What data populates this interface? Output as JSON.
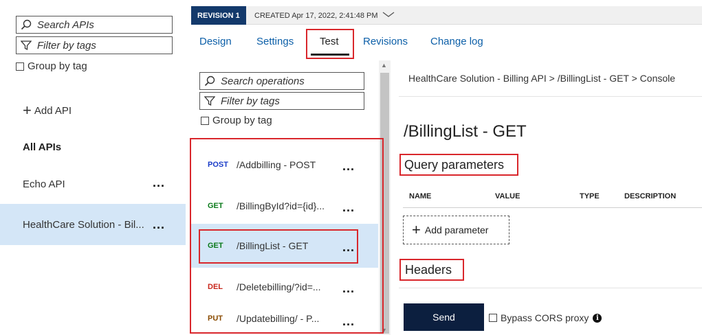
{
  "left_panel": {
    "search_placeholder": "Search APIs",
    "filter_placeholder": "Filter by tags",
    "group_by_tag": "Group by tag",
    "add_api": "Add API",
    "all_apis": "All APIs",
    "apis": [
      {
        "name": "Echo API"
      },
      {
        "name": "HealthCare Solution - Bil..."
      }
    ],
    "more": "..."
  },
  "revision_bar": {
    "tag": "REVISION 1",
    "created": "CREATED Apr 17, 2022, 2:41:48 PM"
  },
  "tabs": [
    {
      "label": "Design"
    },
    {
      "label": "Settings"
    },
    {
      "label": "Test"
    },
    {
      "label": "Revisions"
    },
    {
      "label": "Change log"
    }
  ],
  "operations_panel": {
    "search_placeholder": "Search operations",
    "filter_placeholder": "Filter by tags",
    "group_by_tag": "Group by tag",
    "operations": [
      {
        "verb": "POST",
        "path": "/Addbilling - POST",
        "color": "#1a3cc8"
      },
      {
        "verb": "GET",
        "path": "/BillingById?id={id}...",
        "color": "#0a7a1a"
      },
      {
        "verb": "GET",
        "path": "/BillingList - GET",
        "color": "#0a7a1a"
      },
      {
        "verb": "DEL",
        "path": "/Deletebilling/?id=...",
        "color": "#c8261b"
      },
      {
        "verb": "PUT",
        "path": "/Updatebilling/ - P...",
        "color": "#8a4b00"
      }
    ],
    "more": "..."
  },
  "console": {
    "breadcrumb": "HealthCare Solution - Billing API > /BillingList - GET > Console",
    "title": "/BillingList - GET",
    "query_params_heading": "Query parameters",
    "columns": [
      "NAME",
      "VALUE",
      "TYPE",
      "DESCRIPTION"
    ],
    "add_parameter": "Add parameter",
    "headers_heading": "Headers",
    "send": "Send",
    "bypass_cors": "Bypass CORS proxy"
  },
  "colors": {
    "accent": "#0c5fa8",
    "highlight": "#d4e6f7",
    "annotation_red": "#d9262b",
    "send_bg": "#0c1f3f"
  }
}
